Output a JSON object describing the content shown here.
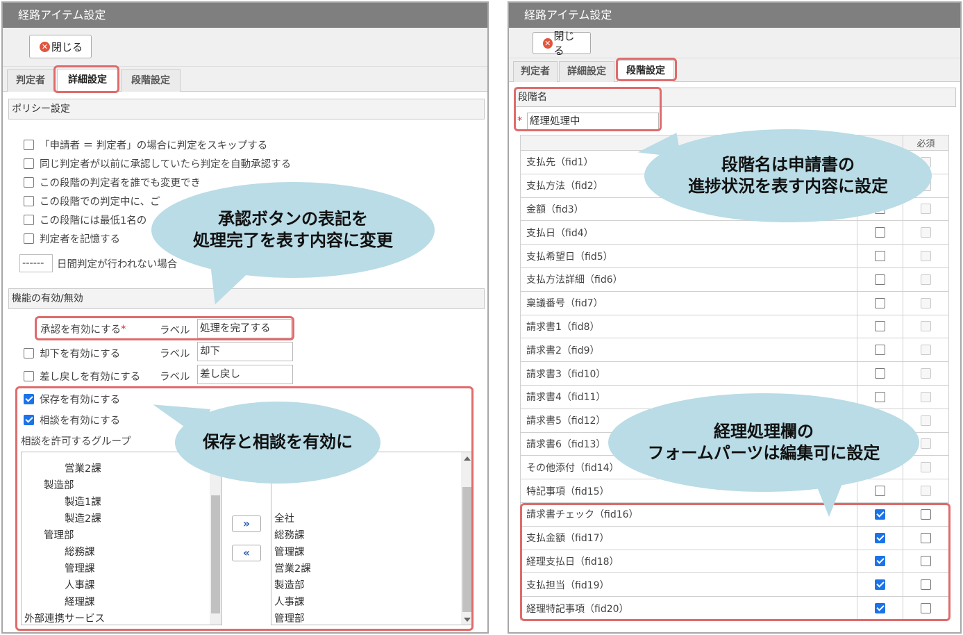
{
  "left": {
    "window_title": "経路アイテム設定",
    "close_label": "閉じる",
    "tabs": [
      {
        "label": "判定者"
      },
      {
        "label": "詳細設定"
      },
      {
        "label": "段階設定"
      }
    ],
    "policy_header": "ポリシー設定",
    "policy_items": [
      {
        "label": "「申請者 ＝ 判定者」の場合に判定をスキップする"
      },
      {
        "label": "同じ判定者が以前に承認していたら判定を自動承認する"
      },
      {
        "label": "この段階の判定者を誰でも変更でき"
      },
      {
        "label": "この段階での判定中に、ご"
      },
      {
        "label": "この段階には最低1名の"
      },
      {
        "label": "判定者を記憶する"
      }
    ],
    "days_value": "------",
    "days_label": "日間判定が行われない場合",
    "features_header": "機能の有効/無効",
    "approve_label": "承認を有効にする",
    "required_mark": "*",
    "label_word": "ラベル",
    "approve_value": "処理を完了する",
    "reject_label": "却下を有効にする",
    "reject_value": "却下",
    "sendback_label": "差し戻しを有効にする",
    "sendback_value": "差し戻し",
    "save_label": "保存を有効にする",
    "consult_label": "相談を有効にする",
    "groups_label": "相談を許可するグループ",
    "source_groups": [
      "営業2課",
      "製造部",
      "製造1課",
      "製造2課",
      "管理部",
      "総務課",
      "管理課",
      "人事課",
      "経理課",
      "外部連携サービス"
    ],
    "target_groups": [
      "全社",
      "総務課",
      "管理課",
      "営業2課",
      "製造部",
      "人事課",
      "管理部"
    ],
    "add_arrow": "»",
    "remove_arrow": "«"
  },
  "right": {
    "window_title": "経路アイテム設定",
    "close_label": "閉じる",
    "tabs": [
      {
        "label": "判定者"
      },
      {
        "label": "詳細設定"
      },
      {
        "label": "段階設定"
      }
    ],
    "stage_name_header": "段階名",
    "required_mark": "*",
    "stage_name_value": "経理処理中",
    "col_required": "必須",
    "fields": [
      {
        "name": "支払先（fid1）",
        "editable": false,
        "required": false
      },
      {
        "name": "支払方法（fid2）",
        "editable": false,
        "required": false
      },
      {
        "name": "金額（fid3）",
        "editable": false,
        "required": false
      },
      {
        "name": "支払日（fid4）",
        "editable": false,
        "required": false
      },
      {
        "name": "支払希望日（fid5）",
        "editable": false,
        "required": false
      },
      {
        "name": "支払方法詳細（fid6）",
        "editable": false,
        "required": false
      },
      {
        "name": "稟議番号（fid7）",
        "editable": false,
        "required": false
      },
      {
        "name": "請求書1（fid8）",
        "editable": false,
        "required": false
      },
      {
        "name": "請求書2（fid9）",
        "editable": false,
        "required": false
      },
      {
        "name": "請求書3（fid10）",
        "editable": false,
        "required": false
      },
      {
        "name": "請求書4（fid11）",
        "editable": false,
        "required": false
      },
      {
        "name": "請求書5（fid12）",
        "editable": false,
        "required": false
      },
      {
        "name": "請求書6（fid13）",
        "editable": false,
        "required": false
      },
      {
        "name": "その他添付（fid14）",
        "editable": false,
        "required": false
      },
      {
        "name": "特記事項（fid15）",
        "editable": false,
        "required": false
      },
      {
        "name": "請求書チェック（fid16）",
        "editable": true,
        "required": false
      },
      {
        "name": "支払金額（fid17）",
        "editable": true,
        "required": false
      },
      {
        "name": "経理支払日（fid18）",
        "editable": true,
        "required": false
      },
      {
        "name": "支払担当（fid19）",
        "editable": true,
        "required": false
      },
      {
        "name": "経理特記事項（fid20）",
        "editable": true,
        "required": false
      }
    ]
  },
  "callouts": {
    "approve_line1": "承認ボタンの表記を",
    "approve_line2": "処理完了を表す内容に変更",
    "save_consult": "保存と相談を有効に",
    "stage_line1": "段階名は申請書の",
    "stage_line2": "進捗状況を表す内容に設定",
    "form_line1": "経理処理欄の",
    "form_line2": "フォームパーツは編集可に設定"
  },
  "colors": {
    "titlebar": "#7f7f7f",
    "highlight": "#df6b6b",
    "callout": "#b9dce6",
    "checkbox_checked": "#1a73e8"
  }
}
